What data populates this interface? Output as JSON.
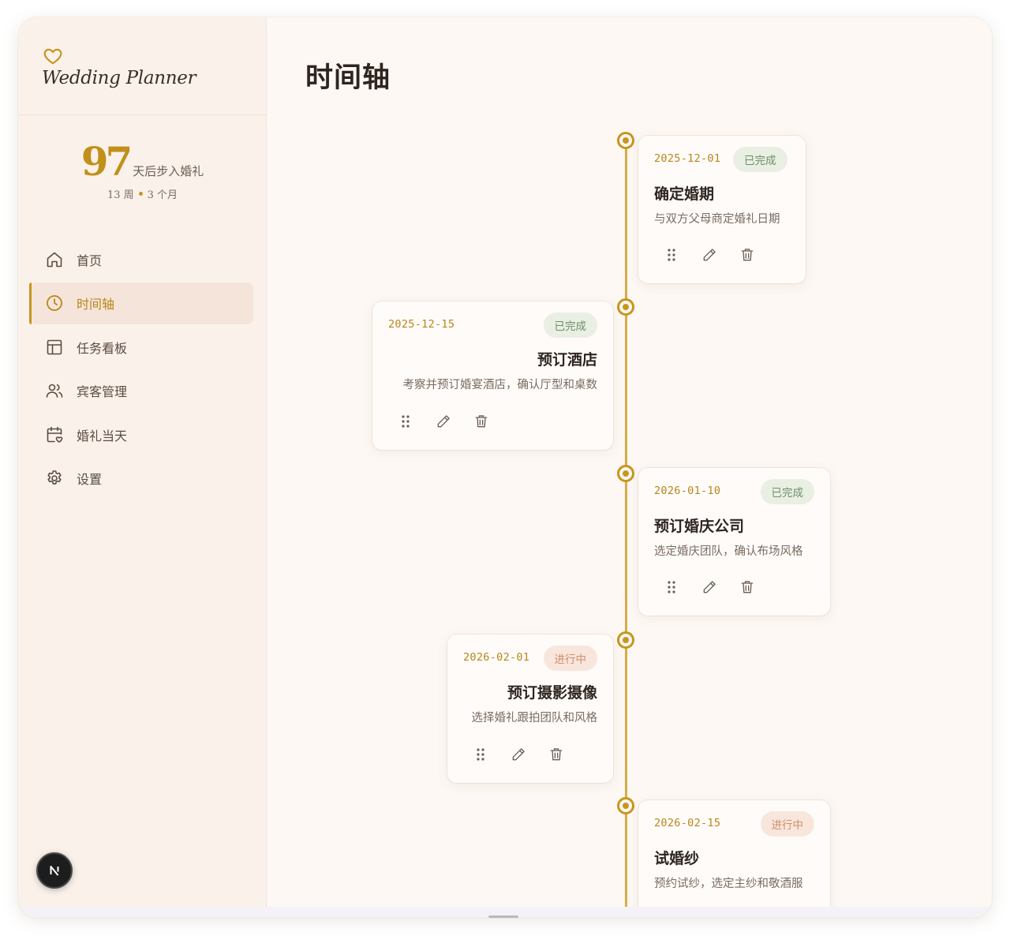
{
  "brand": {
    "name": "Wedding Planner"
  },
  "countdown": {
    "days": "97",
    "label": "天后步入婚礼",
    "weeks": "13 周",
    "months": "3 个月"
  },
  "nav": [
    {
      "label": "首页",
      "icon": "home-icon",
      "active": false
    },
    {
      "label": "时间轴",
      "icon": "clock-icon",
      "active": true
    },
    {
      "label": "任务看板",
      "icon": "board-icon",
      "active": false
    },
    {
      "label": "宾客管理",
      "icon": "users-icon",
      "active": false
    },
    {
      "label": "婚礼当天",
      "icon": "calendar-heart-icon",
      "active": false
    },
    {
      "label": "设置",
      "icon": "gear-icon",
      "active": false
    }
  ],
  "page": {
    "title": "时间轴"
  },
  "timeline": [
    {
      "date": "2025-12-01",
      "status": "已完成",
      "status_type": "done",
      "title": "确定婚期",
      "desc": "与双方父母商定婚礼日期"
    },
    {
      "date": "2025-12-15",
      "status": "已完成",
      "status_type": "done",
      "title": "预订酒店",
      "desc": "考察并预订婚宴酒店，确认厅型和桌数"
    },
    {
      "date": "2026-01-10",
      "status": "已完成",
      "status_type": "done",
      "title": "预订婚庆公司",
      "desc": "选定婚庆团队，确认布场风格"
    },
    {
      "date": "2026-02-01",
      "status": "进行中",
      "status_type": "progress",
      "title": "预订摄影摄像",
      "desc": "选择婚礼跟拍团队和风格"
    },
    {
      "date": "2026-02-15",
      "status": "进行中",
      "status_type": "progress",
      "title": "试婚纱",
      "desc": "预约试纱，选定主纱和敬酒服"
    }
  ],
  "colors": {
    "accent": "#c8961f",
    "done_bg": "#e9efe3",
    "done_fg": "#6d8f68",
    "progress_bg": "#f8e6dc",
    "progress_fg": "#cf8f6a"
  },
  "fab": {
    "icon": "plus-icon"
  },
  "dev_badge": {
    "letter": "N"
  }
}
